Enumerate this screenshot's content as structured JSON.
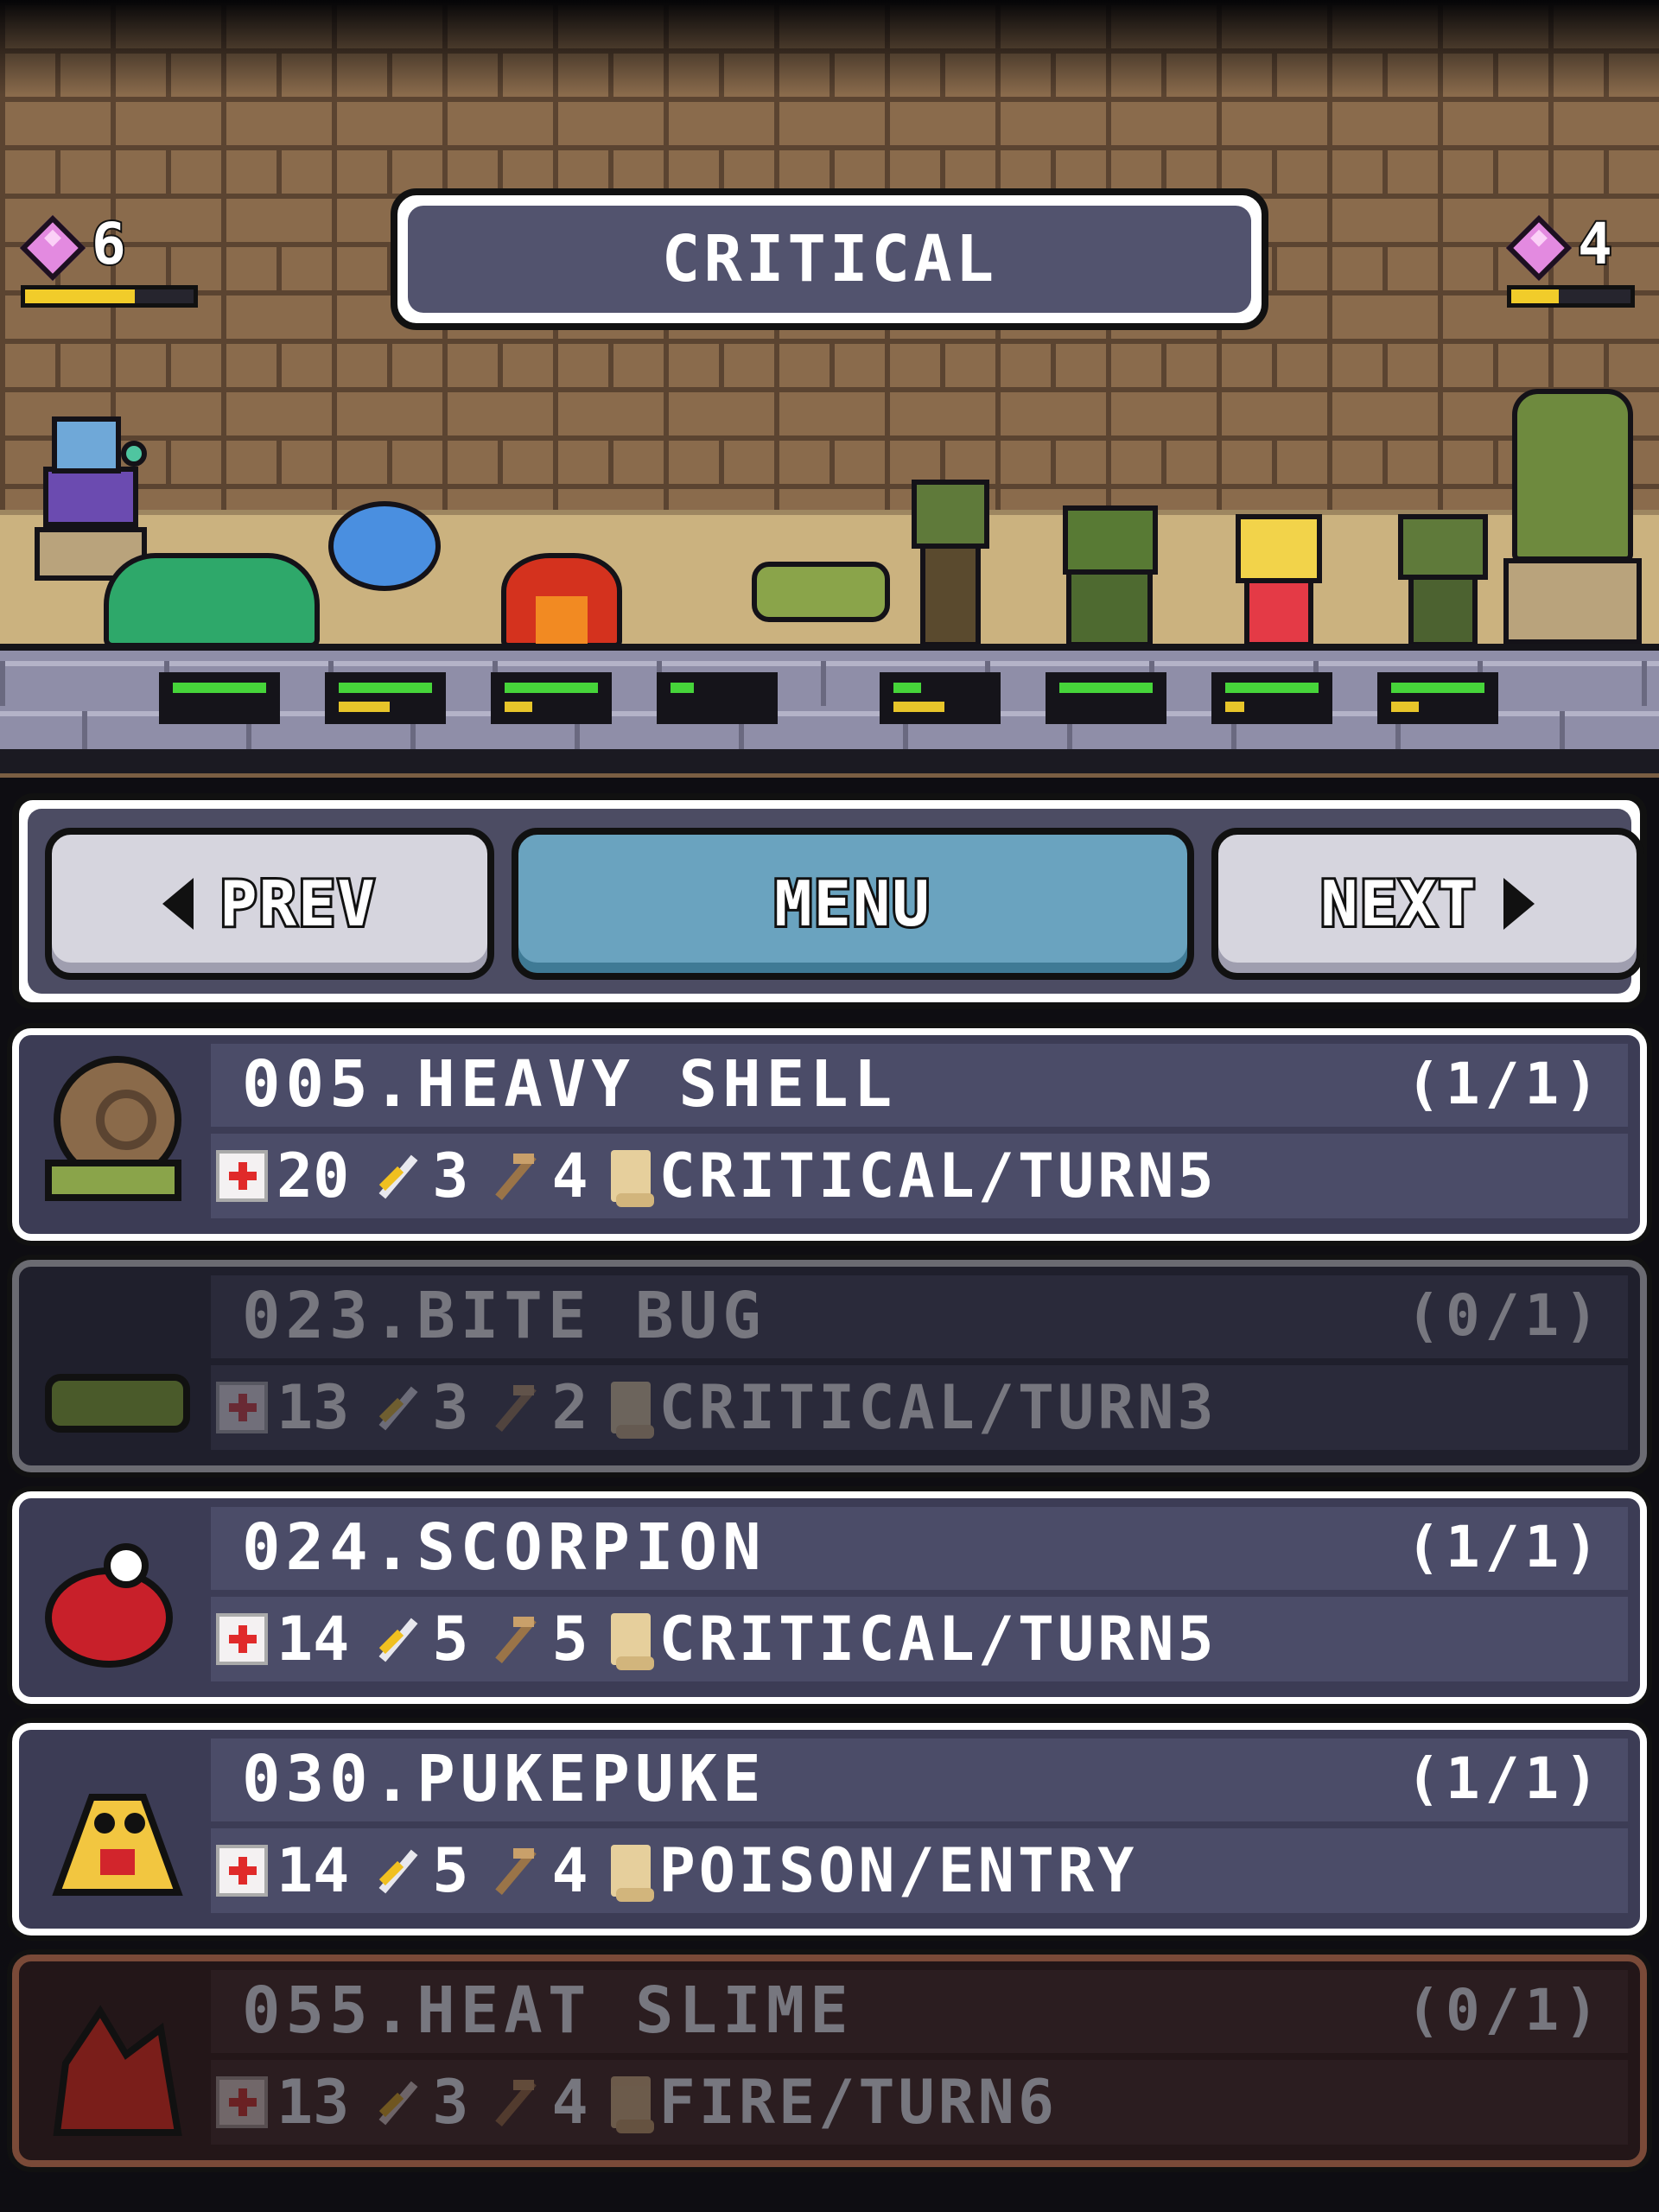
{
  "header": {
    "title": "CRITICAL",
    "gems_left": {
      "count": "6",
      "progress": 0.65
    },
    "gems_right": {
      "count": "4",
      "progress": 0.4
    }
  },
  "party_hp": [
    {
      "hp": 1.0,
      "energy": 0.0
    },
    {
      "hp": 1.0,
      "energy": 0.55
    },
    {
      "hp": 1.0,
      "energy": 0.3
    },
    {
      "hp": 0.25,
      "energy": 0.0
    },
    {
      "hp": 0.3,
      "energy": 0.55
    },
    {
      "hp": 1.0,
      "energy": 0.0
    },
    {
      "hp": 1.0,
      "energy": 0.2
    },
    {
      "hp": 1.0,
      "energy": 0.3
    }
  ],
  "nav": {
    "prev_label": "PREV",
    "menu_label": "MENU",
    "next_label": "NEXT"
  },
  "entries": [
    {
      "name": "005.HEAVY SHELL",
      "count": "(1/1)",
      "hp": "20",
      "atk": "3",
      "spd": "4",
      "skill": "CRITICAL/TURN5",
      "locked": false
    },
    {
      "name": "023.BITE BUG",
      "count": "(0/1)",
      "hp": "13",
      "atk": "3",
      "spd": "2",
      "skill": "CRITICAL/TURN3",
      "locked": true
    },
    {
      "name": "024.SCORPION",
      "count": "(1/1)",
      "hp": "14",
      "atk": "5",
      "spd": "5",
      "skill": "CRITICAL/TURN5",
      "locked": false
    },
    {
      "name": "030.PUKEPUKE",
      "count": "(1/1)",
      "hp": "14",
      "atk": "5",
      "spd": "4",
      "skill": "POISON/ENTRY",
      "locked": false
    },
    {
      "name": "055.HEAT SLIME",
      "count": "(0/1)",
      "hp": "13",
      "atk": "3",
      "spd": "4",
      "skill": "FIRE/TURN6",
      "locked": true
    }
  ],
  "colors": {
    "panel_bg": "#3c3c55",
    "menu_button": "#6aa3bf",
    "hp_green": "#46d43a",
    "energy_yellow": "#e7c52a"
  }
}
